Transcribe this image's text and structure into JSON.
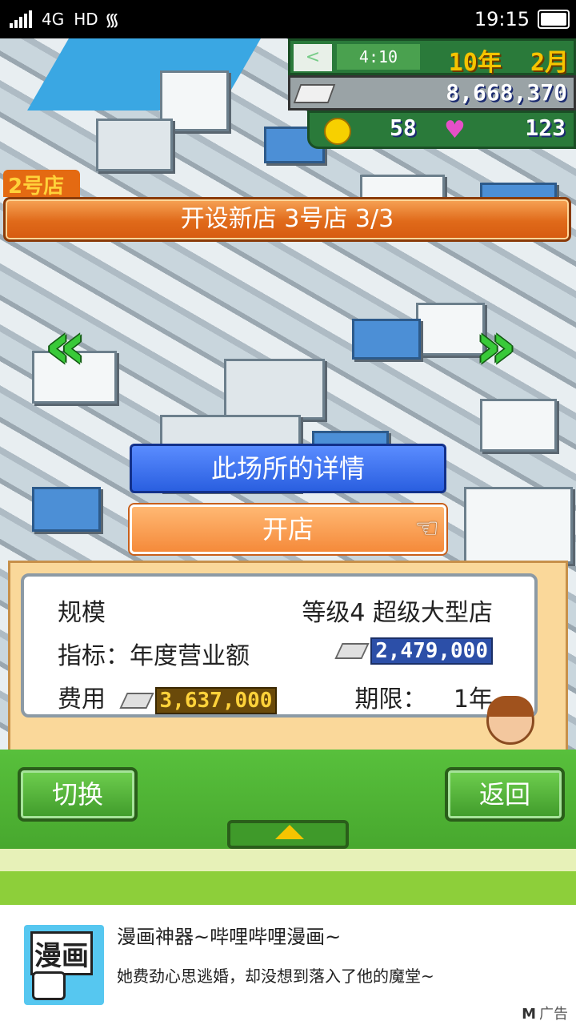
{
  "status_bar": {
    "network": "4G",
    "hd": "HD",
    "time": "19:15"
  },
  "hud": {
    "clock": "4:10",
    "year": "10年",
    "month": "2月",
    "money": "8,668,370",
    "coins": "58",
    "hearts": "123"
  },
  "store_tag": "2号店",
  "title_bar": "开设新店 3号店  3/3",
  "buttons": {
    "detail": "此场所的详情",
    "open": "开店",
    "switch": "切换",
    "back": "返回"
  },
  "info": {
    "scale_label": "规模",
    "scale_value": "等级4 超级大型店",
    "target_label": "指标：年度营业额",
    "target_value": "2,479,000",
    "cost_label": "费用",
    "cost_value": "3,637,000",
    "term_label": "期限：",
    "term_value": "1年"
  },
  "ad": {
    "icon_text": "漫画",
    "title": "漫画神器~哔哩哔哩漫画~",
    "desc": "她费劲心思逃婚，却没想到落入了他的魔堂~",
    "tag": "广告"
  }
}
